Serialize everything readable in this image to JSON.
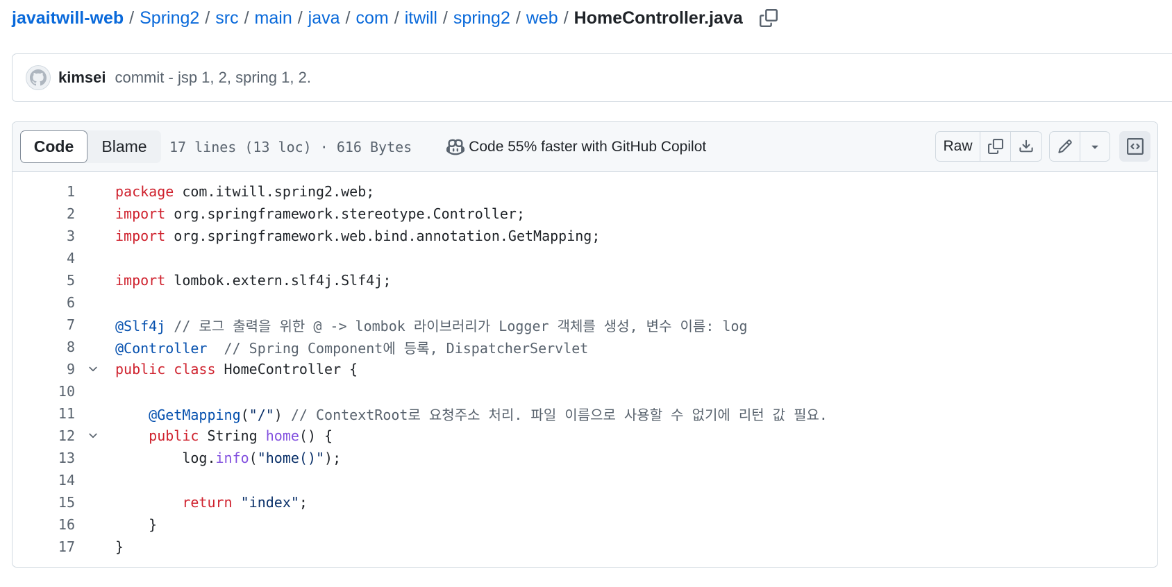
{
  "breadcrumb": {
    "repo": "javaitwill-web",
    "segments": [
      "Spring2",
      "src",
      "main",
      "java",
      "com",
      "itwill",
      "spring2",
      "web"
    ],
    "separator": "/",
    "current": "HomeController.java"
  },
  "commit": {
    "author": "kimsei",
    "message": "commit - jsp 1, 2, spring 1, 2."
  },
  "file_header": {
    "tabs": [
      {
        "label": "Code",
        "active": true
      },
      {
        "label": "Blame",
        "active": false
      }
    ],
    "meta": "17 lines (13 loc) · 616 Bytes",
    "copilot": "Code 55% faster with GitHub Copilot",
    "raw_label": "Raw"
  },
  "icons": {
    "copy_path": "copy-icon",
    "avatar": "github-octocat-icon",
    "copilot": "copilot-icon",
    "copy_raw": "copy-icon",
    "download": "download-icon",
    "edit": "pencil-icon",
    "more_edit": "triangle-down-icon",
    "symbols": "code-square-icon",
    "fold": "chevron-down-icon"
  },
  "colors": {
    "link": "#0969da",
    "keyword": "#cf222e",
    "annotation": "#0550ae",
    "string": "#0a3069",
    "function": "#8250df",
    "comment": "#59636e",
    "text": "#1f2328",
    "border": "#d1d9e0",
    "header_bg": "#f6f8fa"
  },
  "code": {
    "lines": [
      {
        "n": "1",
        "fold": false,
        "tokens": [
          {
            "t": "package",
            "c": "kw"
          },
          {
            "t": " com.itwill.spring2.web;",
            "c": ""
          }
        ]
      },
      {
        "n": "2",
        "fold": false,
        "tokens": [
          {
            "t": "import",
            "c": "kw"
          },
          {
            "t": " org.springframework.stereotype.Controller;",
            "c": ""
          }
        ]
      },
      {
        "n": "3",
        "fold": false,
        "tokens": [
          {
            "t": "import",
            "c": "kw"
          },
          {
            "t": " org.springframework.web.bind.annotation.GetMapping;",
            "c": ""
          }
        ]
      },
      {
        "n": "4",
        "fold": false,
        "tokens": []
      },
      {
        "n": "5",
        "fold": false,
        "tokens": [
          {
            "t": "import",
            "c": "kw"
          },
          {
            "t": " lombok.extern.slf4j.Slf4j;",
            "c": ""
          }
        ]
      },
      {
        "n": "6",
        "fold": false,
        "tokens": []
      },
      {
        "n": "7",
        "fold": false,
        "tokens": [
          {
            "t": "@Slf4j",
            "c": "an"
          },
          {
            "t": " ",
            "c": ""
          },
          {
            "t": "// 로그 출력을 위한 @ -> lombok 라이브러리가 Logger 객체를 생성, 변수 이름: log",
            "c": "cm"
          }
        ]
      },
      {
        "n": "8",
        "fold": false,
        "tokens": [
          {
            "t": "@Controller",
            "c": "an"
          },
          {
            "t": "  ",
            "c": ""
          },
          {
            "t": "// Spring Component에 등록, DispatcherServlet",
            "c": "cm"
          }
        ]
      },
      {
        "n": "9",
        "fold": true,
        "tokens": [
          {
            "t": "public",
            "c": "kw"
          },
          {
            "t": " ",
            "c": ""
          },
          {
            "t": "class",
            "c": "kw"
          },
          {
            "t": " HomeController {",
            "c": ""
          }
        ]
      },
      {
        "n": "10",
        "fold": false,
        "tokens": []
      },
      {
        "n": "11",
        "fold": false,
        "tokens": [
          {
            "t": "    ",
            "c": ""
          },
          {
            "t": "@GetMapping",
            "c": "an"
          },
          {
            "t": "(",
            "c": ""
          },
          {
            "t": "\"/\"",
            "c": "st"
          },
          {
            "t": ") ",
            "c": ""
          },
          {
            "t": "// ContextRoot로 요청주소 처리. 파일 이름으로 사용할 수 없기에 리턴 값 필요.",
            "c": "cm"
          }
        ]
      },
      {
        "n": "12",
        "fold": true,
        "tokens": [
          {
            "t": "    ",
            "c": ""
          },
          {
            "t": "public",
            "c": "kw"
          },
          {
            "t": " String ",
            "c": ""
          },
          {
            "t": "home",
            "c": "fn"
          },
          {
            "t": "() {",
            "c": ""
          }
        ]
      },
      {
        "n": "13",
        "fold": false,
        "tokens": [
          {
            "t": "        log.",
            "c": ""
          },
          {
            "t": "info",
            "c": "fn"
          },
          {
            "t": "(",
            "c": ""
          },
          {
            "t": "\"home()\"",
            "c": "st"
          },
          {
            "t": ");",
            "c": ""
          }
        ]
      },
      {
        "n": "14",
        "fold": false,
        "tokens": []
      },
      {
        "n": "15",
        "fold": false,
        "tokens": [
          {
            "t": "        ",
            "c": ""
          },
          {
            "t": "return",
            "c": "kw"
          },
          {
            "t": " ",
            "c": ""
          },
          {
            "t": "\"index\"",
            "c": "st"
          },
          {
            "t": ";",
            "c": ""
          }
        ]
      },
      {
        "n": "16",
        "fold": false,
        "tokens": [
          {
            "t": "    }",
            "c": ""
          }
        ]
      },
      {
        "n": "17",
        "fold": false,
        "tokens": [
          {
            "t": "}",
            "c": ""
          }
        ]
      }
    ]
  }
}
